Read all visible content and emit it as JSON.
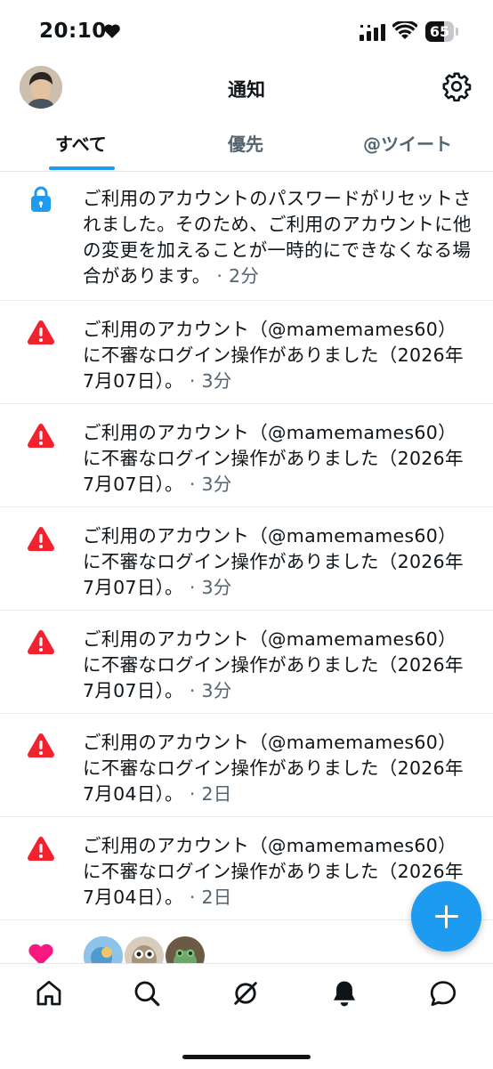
{
  "status_bar": {
    "time": "20:10",
    "battery": "65",
    "battery_percent": 65
  },
  "header": {
    "title": "通知"
  },
  "tabs": [
    {
      "label": "すべて"
    },
    {
      "label": "優先"
    },
    {
      "label": "@ツイート"
    }
  ],
  "notifications": [
    {
      "icon": "lock-icon",
      "text": "ご利用のアカウントのパスワードがリセットされました。そのため、ご利用のアカウントに他の変更を加えることが一時的にできなくなる場合があります。",
      "time": "· 2分"
    },
    {
      "icon": "warning-icon",
      "text": "ご利用のアカウント（@mamemames60）に不審なログイン操作がありました（2026年7月07日）。",
      "time": "· 3分"
    },
    {
      "icon": "warning-icon",
      "text": "ご利用のアカウント（@mamemames60）に不審なログイン操作がありました（2026年7月07日）。",
      "time": "· 3分"
    },
    {
      "icon": "warning-icon",
      "text": "ご利用のアカウント（@mamemames60）に不審なログイン操作がありました（2026年7月07日）。",
      "time": "· 3分"
    },
    {
      "icon": "warning-icon",
      "text": "ご利用のアカウント（@mamemames60）に不審なログイン操作がありました（2026年7月07日）。",
      "time": "· 3分"
    },
    {
      "icon": "warning-icon",
      "text": "ご利用のアカウント（@mamemames60）に不審なログイン操作がありました（2026年7月04日）。",
      "time": "· 2日"
    },
    {
      "icon": "warning-icon",
      "text": "ご利用のアカウント（@mamemames60）に不審なログイン操作がありました（2026年7月04日）。",
      "time": "· 2日"
    }
  ],
  "colors": {
    "accent": "#1d9bf0",
    "alert": "#f4212e",
    "like": "#f91880",
    "text": "#0f1419",
    "muted": "#536471"
  },
  "bottom_nav": [
    "home-icon",
    "search-icon",
    "spaces-icon",
    "notifications-icon",
    "messages-icon"
  ]
}
